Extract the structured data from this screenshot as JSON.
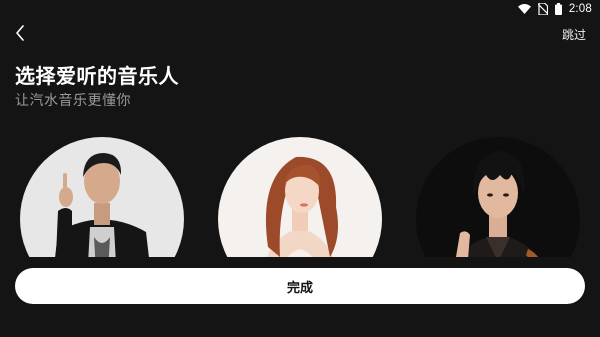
{
  "status_bar": {
    "time": "2:08",
    "icons": [
      "wifi-icon",
      "no-sim-icon",
      "battery-icon"
    ]
  },
  "header": {
    "back_icon": "chevron-left-icon",
    "skip_label": "跳过"
  },
  "main": {
    "title": "选择爱听的音乐人",
    "subtitle": "让汽水音乐更懂你",
    "artists": [
      {
        "kind": "male-artist-photo",
        "background": "#e7e7e7"
      },
      {
        "kind": "female-artist-photo",
        "background": "#f4f1ee"
      },
      {
        "kind": "male-artist-photo",
        "background": "#0d0d0d"
      }
    ]
  },
  "footer": {
    "done_label": "完成"
  },
  "colors": {
    "background": "#141414",
    "button_bg": "#ffffff",
    "button_text": "#111111",
    "subtitle": "#9a9a9a"
  }
}
